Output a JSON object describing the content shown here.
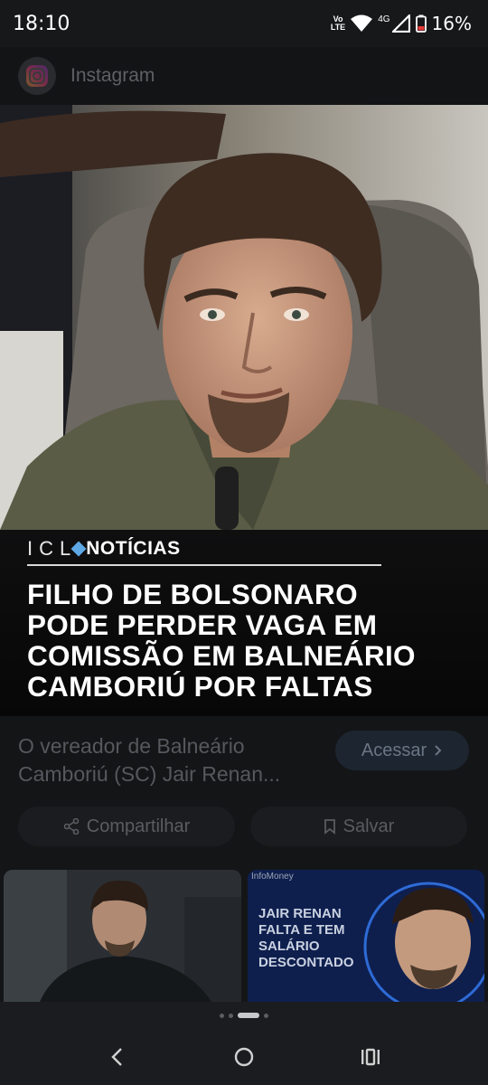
{
  "status_bar": {
    "time": "18:10",
    "volte_line1": "Vo",
    "volte_line2": "LTE",
    "network": "4G",
    "battery": "16%"
  },
  "header": {
    "app_name": "Instagram",
    "app_icon": "instagram-icon"
  },
  "hero": {
    "brand_icl": "ICL",
    "brand_noticias": "NOTÍCIAS",
    "headline_lines": [
      "FILHO DE BOLSONARO",
      "PODE PERDER VAGA EM",
      "COMISSÃO EM BALNEÁRIO",
      "CAMBORIÚ POR FALTAS"
    ]
  },
  "card": {
    "description_lines": [
      "O vereador de Balneário",
      "Camboriú (SC) Jair Renan..."
    ],
    "access_label": "Acessar",
    "share_label": "Compartilhar",
    "save_label": "Salvar"
  },
  "related": {
    "thumb2_source": "InfoMoney",
    "thumb2_text": "JAIR RENAN FALTA E TEM SALÁRIO DESCONTADO"
  },
  "pager": {
    "count": 4,
    "active_index": 2
  },
  "navbar": {
    "icons": [
      "back-icon",
      "home-icon",
      "recents-icon"
    ]
  },
  "colors": {
    "background": "#17181a",
    "accent_blue": "#5fa8e6",
    "headline_text": "#ffffff"
  }
}
